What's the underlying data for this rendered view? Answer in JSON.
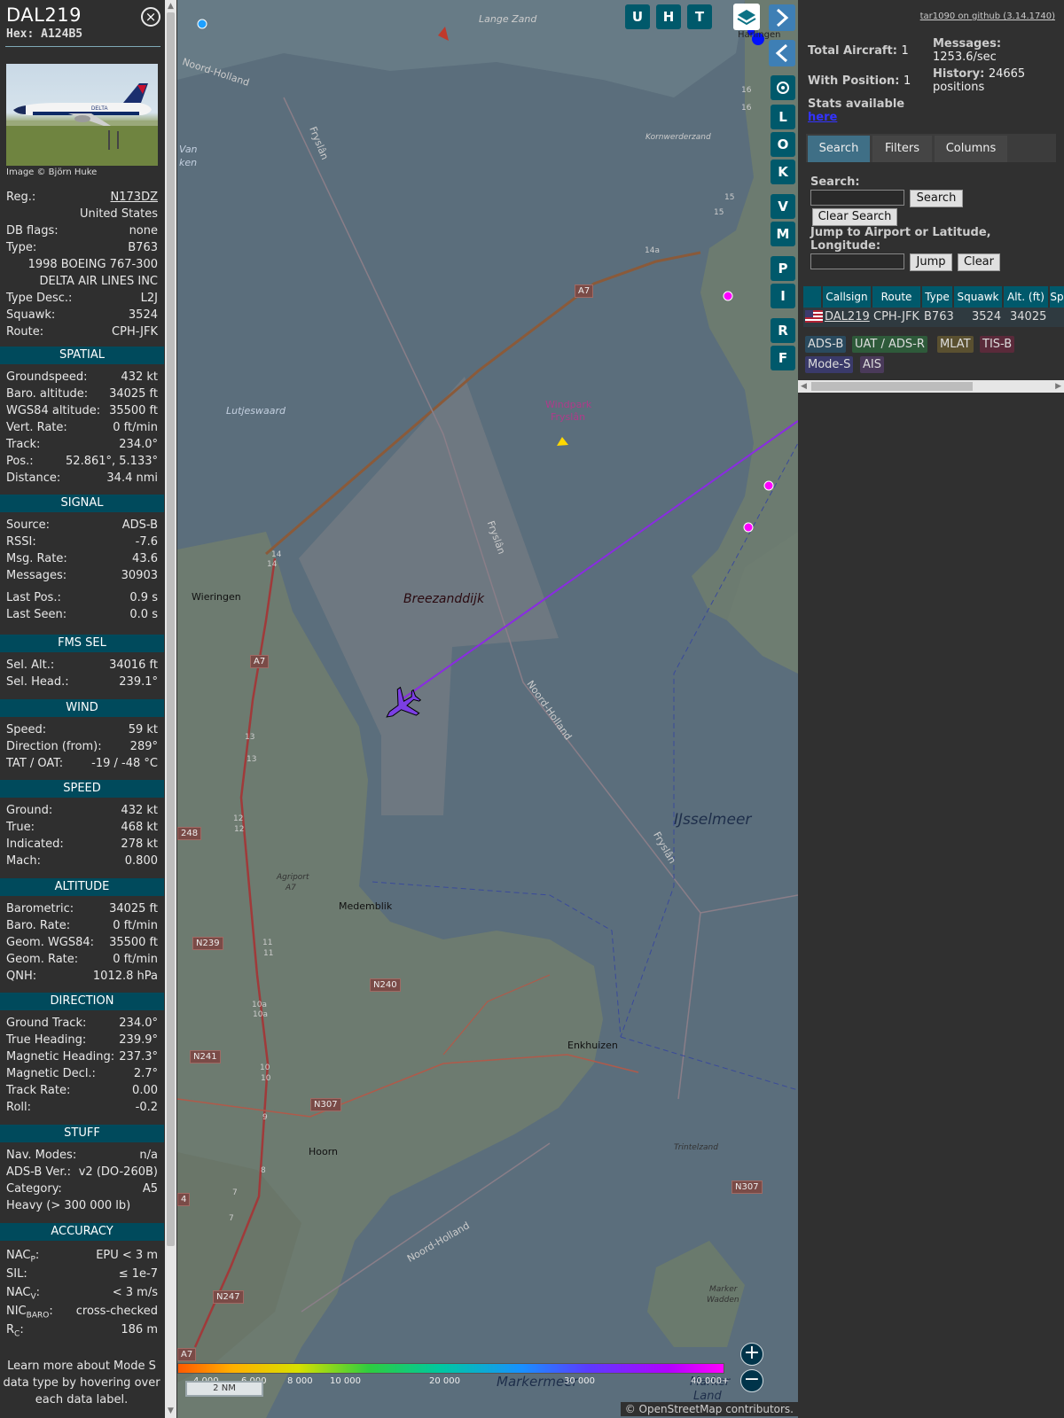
{
  "aircraft": {
    "callsign": "DAL219",
    "hex_label": "Hex: A124B5",
    "image_credit": "Image © Björn Huke",
    "details": [
      {
        "k": "Reg.:",
        "v": "N173DZ"
      },
      {
        "k": "",
        "v": "United States"
      },
      {
        "k": "DB flags:",
        "v": "none"
      },
      {
        "k": "Type:",
        "v": "B763"
      },
      {
        "k": "",
        "v": "1998 BOEING 767-300"
      },
      {
        "k": "",
        "v": "DELTA AIR LINES INC"
      },
      {
        "k": "Type Desc.:",
        "v": "L2J"
      },
      {
        "k": "Squawk:",
        "v": "3524"
      },
      {
        "k": "Route:",
        "v": "CPH-JFK"
      }
    ]
  },
  "sections": {
    "spatial": {
      "title": "SPATIAL",
      "rows": [
        {
          "k": "Groundspeed:",
          "v": "432 kt"
        },
        {
          "k": "Baro. altitude:",
          "v": "34025 ft"
        },
        {
          "k": "WGS84 altitude:",
          "v": "35500 ft"
        },
        {
          "k": "Vert. Rate:",
          "v": "0 ft/min"
        },
        {
          "k": "Track:",
          "v": "234.0°"
        },
        {
          "k": "Pos.:",
          "v": "52.861°, 5.133°"
        },
        {
          "k": "Distance:",
          "v": "34.4 nmi"
        }
      ]
    },
    "signal": {
      "title": "SIGNAL",
      "rows": [
        {
          "k": "Source:",
          "v": "ADS-B"
        },
        {
          "k": "RSSI:",
          "v": "-7.6"
        },
        {
          "k": "Msg. Rate:",
          "v": "43.6"
        },
        {
          "k": "Messages:",
          "v": "30903"
        },
        {
          "k": "Last Pos.:",
          "v": "0.9 s"
        },
        {
          "k": "Last Seen:",
          "v": "0.0 s"
        }
      ]
    },
    "fms": {
      "title": "FMS SEL",
      "rows": [
        {
          "k": "Sel. Alt.:",
          "v": "34016 ft"
        },
        {
          "k": "Sel. Head.:",
          "v": "239.1°"
        }
      ]
    },
    "wind": {
      "title": "WIND",
      "rows": [
        {
          "k": "Speed:",
          "v": "59 kt"
        },
        {
          "k": "Direction (from):",
          "v": "289°"
        },
        {
          "k": "TAT / OAT:",
          "v": "-19 / -48 °C"
        }
      ]
    },
    "speed": {
      "title": "SPEED",
      "rows": [
        {
          "k": "Ground:",
          "v": "432 kt"
        },
        {
          "k": "True:",
          "v": "468 kt"
        },
        {
          "k": "Indicated:",
          "v": "278 kt"
        },
        {
          "k": "Mach:",
          "v": "0.800"
        }
      ]
    },
    "altitude": {
      "title": "ALTITUDE",
      "rows": [
        {
          "k": "Barometric:",
          "v": "34025 ft"
        },
        {
          "k": "Baro. Rate:",
          "v": "0 ft/min"
        },
        {
          "k": "Geom. WGS84:",
          "v": "35500 ft"
        },
        {
          "k": "Geom. Rate:",
          "v": "0 ft/min"
        },
        {
          "k": "QNH:",
          "v": "1012.8 hPa"
        }
      ]
    },
    "direction": {
      "title": "DIRECTION",
      "rows": [
        {
          "k": "Ground Track:",
          "v": "234.0°"
        },
        {
          "k": "True Heading:",
          "v": "239.9°"
        },
        {
          "k": "Magnetic Heading:",
          "v": "237.3°"
        },
        {
          "k": "Magnetic Decl.:",
          "v": "2.7°"
        },
        {
          "k": "Track Rate:",
          "v": "0.00"
        },
        {
          "k": "Roll:",
          "v": "-0.2"
        }
      ]
    },
    "stuff": {
      "title": "STUFF",
      "rows": [
        {
          "k": "Nav. Modes:",
          "v": "n/a"
        },
        {
          "k": "ADS-B Ver.:",
          "v": "v2 (DO-260B)"
        },
        {
          "k": "Category:",
          "v": "A5"
        },
        {
          "k": "Heavy (> 300 000 lb)",
          "v": ""
        }
      ]
    },
    "accuracy": {
      "title": "ACCURACY",
      "rows": [
        {
          "k": "NAC",
          "sub": "P",
          "suffix": ":",
          "v": "EPU < 3 m"
        },
        {
          "k": "SIL:",
          "sub": "",
          "suffix": "",
          "v": "≤ 1e-7"
        },
        {
          "k": "NAC",
          "sub": "V",
          "suffix": ":",
          "v": "< 3 m/s"
        },
        {
          "k": "NIC",
          "sub": "BARO",
          "suffix": ":",
          "v": "cross-checked"
        },
        {
          "k": "R",
          "sub": "C",
          "suffix": ":",
          "v": "186 m"
        }
      ]
    }
  },
  "note": "Learn more about Mode S data type by hovering over each data label.",
  "map": {
    "labels": [
      "Lange Zand",
      "Noord-Holland",
      "Fryslân",
      "Kornwerderzand",
      "Lutjeswaard",
      "Windpark",
      "Fryslân",
      "Breezanddijk",
      "Fryslân",
      "Wieringen",
      "Noord-Holland",
      "IJsselmeer",
      "Fryslân",
      "Medemblik",
      "Agriport",
      "A7",
      "Enkhuizen",
      "Hoorn",
      "Noord-Holland",
      "Trintelzand",
      "Marker",
      "Wadden",
      "Markermeer",
      "Marker",
      "Land",
      "Van",
      "ken",
      "Harlingen"
    ],
    "shields": [
      "A7",
      "A7",
      "N239",
      "N240",
      "N241",
      "N307",
      "N247",
      "N307",
      "248",
      "A7",
      "4"
    ],
    "road_numbers": [
      "14",
      "14",
      "13",
      "13",
      "12",
      "12",
      "11",
      "11",
      "10a",
      "10a",
      "10",
      "10",
      "9",
      "8",
      "7",
      "7",
      "14a",
      "15",
      "15",
      "16",
      "16"
    ],
    "colorbar_ticks": [
      "4 000",
      "6 000",
      "8 000",
      "10 000",
      "20 000",
      "30 000",
      "40 000+"
    ],
    "scale": "2 NM",
    "attribution": "© OpenStreetMap contributors.",
    "buttons": [
      "U",
      "H",
      "T",
      "L",
      "O",
      "K",
      "V",
      "M",
      "P",
      "I",
      "R",
      "F"
    ]
  },
  "right": {
    "github": "tar1090 on github (3.14.1740)",
    "total_aircraft_label": "Total Aircraft:",
    "total_aircraft": "1",
    "with_position_label": "With Position:",
    "with_position": "1",
    "messages_label": "Messages:",
    "messages": "1253.6/sec",
    "history_label": "History:",
    "history": "24665 positions",
    "stats_label": "Stats available",
    "stats_link": "here",
    "tabs": [
      "Search",
      "Filters",
      "Columns"
    ],
    "search_label": "Search:",
    "search_button": "Search",
    "clear_search": "Clear Search",
    "jump_label": "Jump to Airport or Latitude, Longitude:",
    "jump_button": "Jump",
    "clear_button": "Clear",
    "table_headers": [
      "Callsign",
      "Route",
      "Type",
      "Squawk",
      "Alt. (ft)",
      "Sp"
    ],
    "table_row": {
      "callsign": "DAL219",
      "route": "CPH-JFK",
      "type": "B763",
      "squawk": "3524",
      "alt": "34025"
    },
    "badges": [
      "ADS-B",
      "UAT / ADS-R",
      "MLAT",
      "TIS-B",
      "Mode-S",
      "AIS"
    ]
  },
  "colors": {
    "section_header": "#004a5c",
    "button": "#00596b",
    "track_line": "#8a2be2",
    "aircraft": "#7b3fe4"
  }
}
